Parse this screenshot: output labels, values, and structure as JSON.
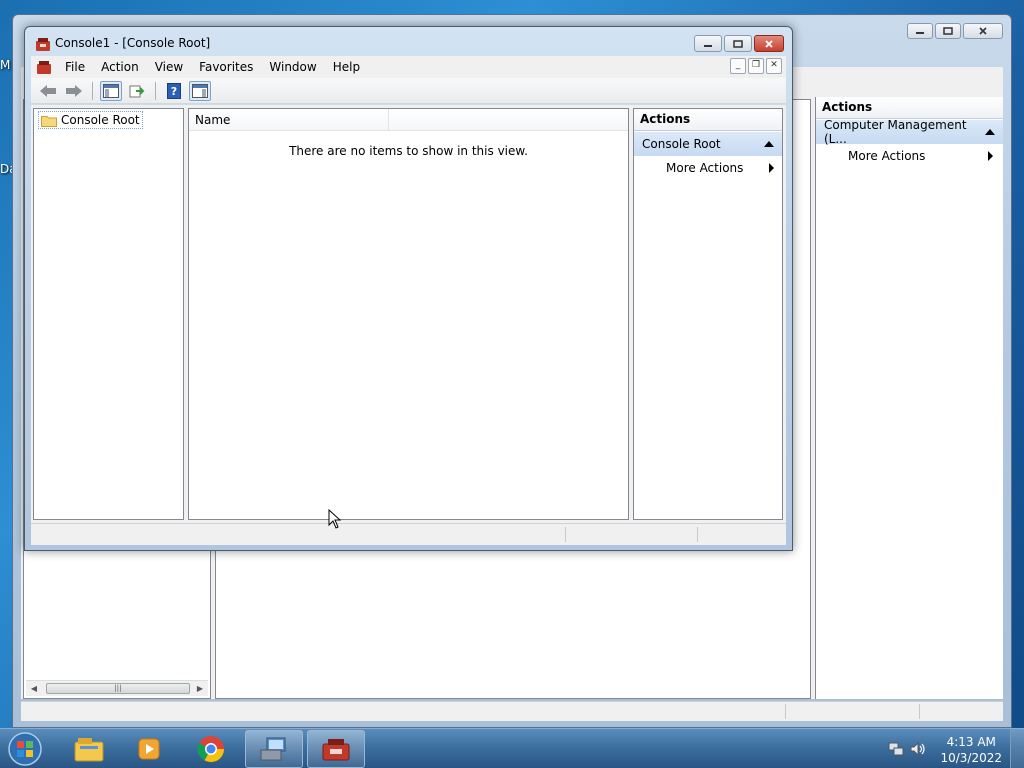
{
  "desktop": {
    "frag_1": "M",
    "frag_2": "Da"
  },
  "bg_window": {
    "actions_header": "Actions",
    "actions_selected": "Computer Management (L...",
    "more_actions": "More Actions",
    "scroll_thumb_grip": "|||"
  },
  "window": {
    "title": "Console1 - [Console Root]",
    "controls": {
      "minimize": "_",
      "maximize": "□",
      "close": "✕"
    },
    "menu": [
      "File",
      "Action",
      "View",
      "Favorites",
      "Window",
      "Help"
    ],
    "mdi_controls": {
      "minimize": "_",
      "restore": "❐",
      "close": "✕"
    },
    "tree": {
      "root": "Console Root"
    },
    "list": {
      "column_name": "Name",
      "empty_message": "There are no items to show in this view."
    },
    "actions": {
      "header": "Actions",
      "selected": "Console Root",
      "more_actions": "More Actions"
    }
  },
  "taskbar": {
    "apps": [
      "windows-explorer",
      "media-player",
      "chrome",
      "computer-management",
      "console"
    ],
    "clock": {
      "time": "4:13 AM",
      "date": "10/3/2022"
    }
  },
  "colors": {
    "title_bar": "#bcd1e7",
    "close_button": "#c8402f",
    "selected_action": "#c6daf2",
    "taskbar": "#3d6f9f",
    "desktop": "#1b5fa3"
  }
}
